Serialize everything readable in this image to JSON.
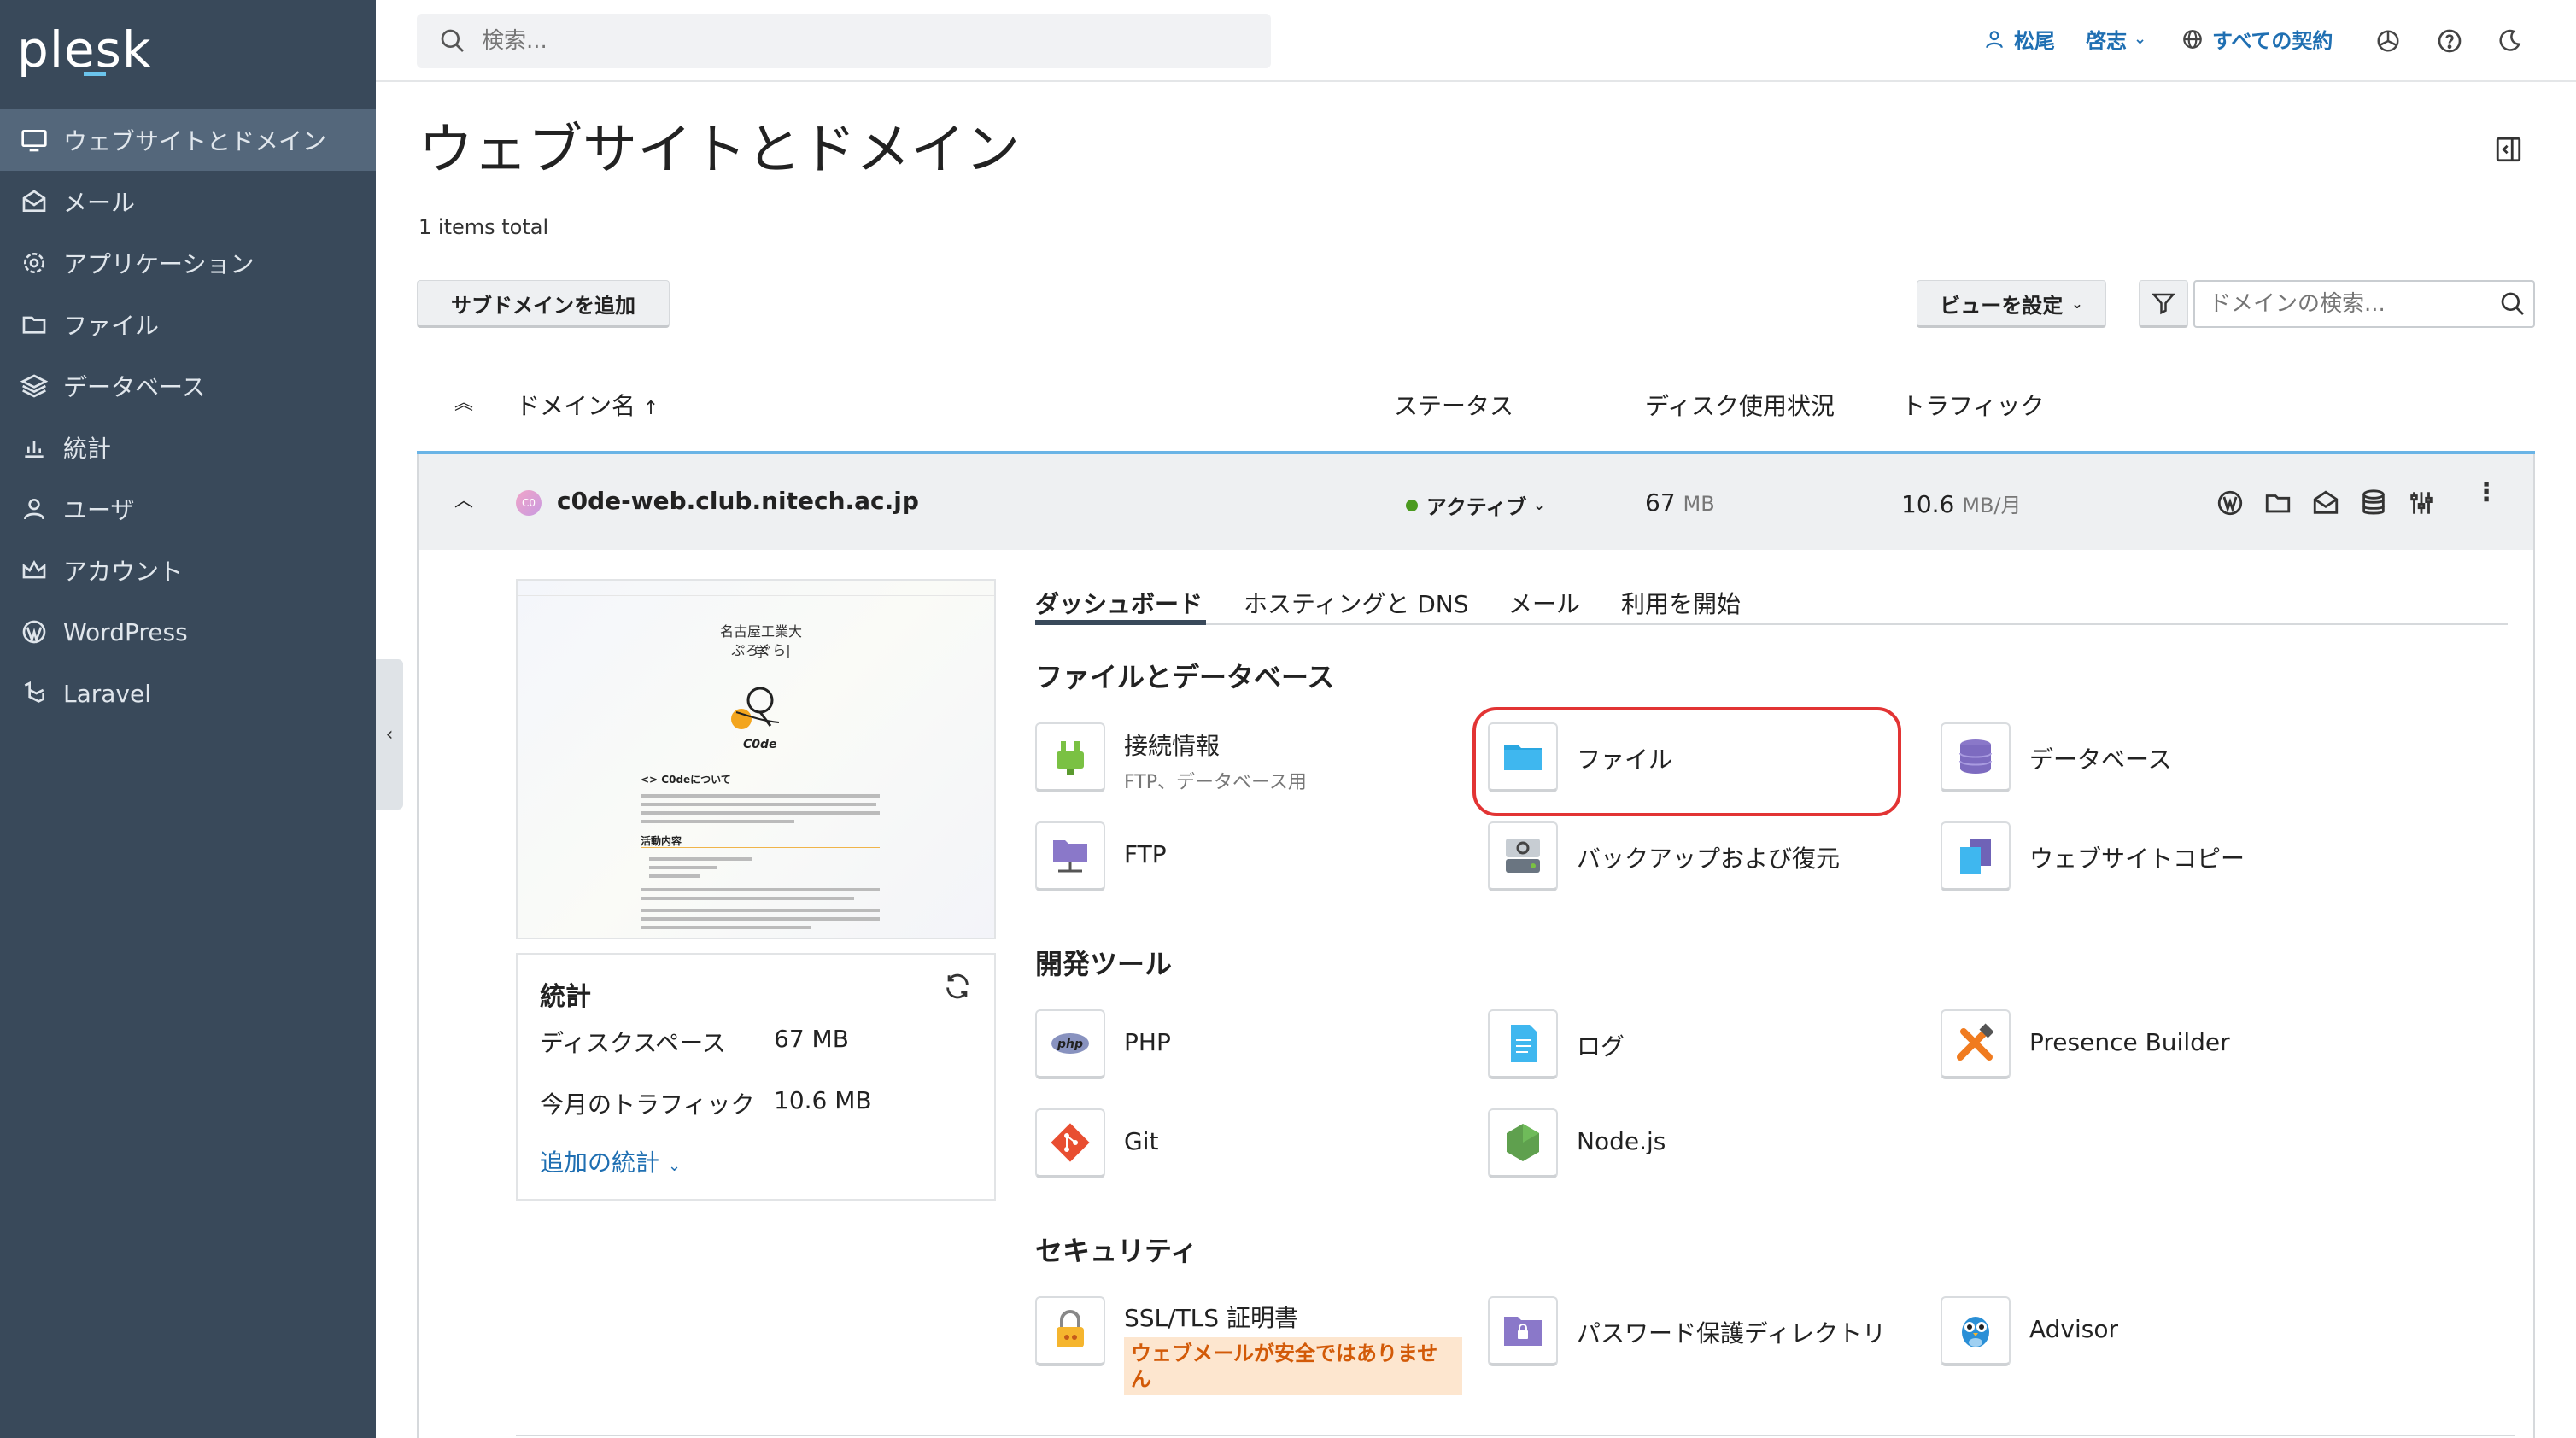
{
  "app": {
    "logo": "plesk"
  },
  "sidebar": {
    "items": [
      {
        "label": "ウェブサイトとドメイン",
        "icon": "monitor-icon",
        "active": true
      },
      {
        "label": "メール",
        "icon": "mail-icon"
      },
      {
        "label": "アプリケーション",
        "icon": "gear-icon"
      },
      {
        "label": "ファイル",
        "icon": "folder-icon"
      },
      {
        "label": "データベース",
        "icon": "layers-icon"
      },
      {
        "label": "統計",
        "icon": "bar-chart-icon"
      },
      {
        "label": "ユーザ",
        "icon": "user-icon"
      },
      {
        "label": "アカウント",
        "icon": "crown-icon"
      },
      {
        "label": "WordPress",
        "icon": "wordpress-icon"
      },
      {
        "label": "Laravel",
        "icon": "laravel-icon"
      }
    ],
    "collapse_glyph": "‹"
  },
  "topbar": {
    "search_placeholder": "検索...",
    "user_surname": "松尾",
    "user_given": "啓志",
    "subscriptions_label": "すべての契約"
  },
  "page": {
    "title": "ウェブサイトとドメイン",
    "items_total": "1 items total",
    "add_subdomain": "サブドメインを追加",
    "set_view": "ビューを設定",
    "domain_search_placeholder": "ドメインの検索..."
  },
  "table": {
    "headers": {
      "domain": "ドメイン名",
      "sort_arrow": "↑",
      "status": "ステータス",
      "disk": "ディスク使用状況",
      "traffic": "トラフィック"
    },
    "row": {
      "avatar": "C0",
      "domain": "c0de-web.club.nitech.ac.jp",
      "status": "アクティブ",
      "status_color": "#4b9a1f",
      "disk_value": "67",
      "disk_unit": "MB",
      "traffic_value": "10.6",
      "traffic_unit": "MB/月"
    }
  },
  "preview": {
    "university": "名古屋工業大学",
    "club": "ぷろぐら|",
    "logo_text": "C0de",
    "about_heading": "<> C0deについて",
    "activity_heading": "活動内容"
  },
  "stats": {
    "title": "統計",
    "disk_label": "ディスクスペース",
    "disk_value": "67 MB",
    "traffic_label": "今月のトラフィック",
    "traffic_value": "10.6 MB",
    "more_label": "追加の統計"
  },
  "tabs": [
    {
      "label": "ダッシュボード",
      "active": true
    },
    {
      "label": "ホスティングと DNS"
    },
    {
      "label": "メール"
    },
    {
      "label": "利用を開始"
    }
  ],
  "sections": {
    "files_db": {
      "title": "ファイルとデータベース",
      "tools": [
        {
          "label": "接続情報",
          "sub": "FTP、データベース用",
          "icon": "plug-icon"
        },
        {
          "label": "ファイル",
          "icon": "folder-icon"
        },
        {
          "label": "データベース",
          "icon": "database-icon"
        },
        {
          "label": "FTP",
          "icon": "ftp-folder-icon"
        },
        {
          "label": "バックアップおよび復元",
          "icon": "backup-icon"
        },
        {
          "label": "ウェブサイトコピー",
          "icon": "copy-icon"
        }
      ]
    },
    "dev": {
      "title": "開発ツール",
      "tools": [
        {
          "label": "PHP",
          "icon": "php-icon"
        },
        {
          "label": "ログ",
          "icon": "log-icon"
        },
        {
          "label": "Presence Builder",
          "icon": "tools-icon"
        },
        {
          "label": "Git",
          "icon": "git-icon"
        },
        {
          "label": "Node.js",
          "icon": "nodejs-icon"
        }
      ]
    },
    "security": {
      "title": "セキュリティ",
      "tools": [
        {
          "label": "SSL/TLS 証明書",
          "warning": "ウェブメールが安全ではありません",
          "icon": "lock-icon"
        },
        {
          "label": "パスワード保護ディレクトリ",
          "icon": "protected-folder-icon"
        },
        {
          "label": "Advisor",
          "icon": "owl-icon"
        }
      ]
    }
  },
  "colors": {
    "sidebar": "#39495a",
    "accent": "#1f6fb2",
    "highlight": "#e23434"
  }
}
